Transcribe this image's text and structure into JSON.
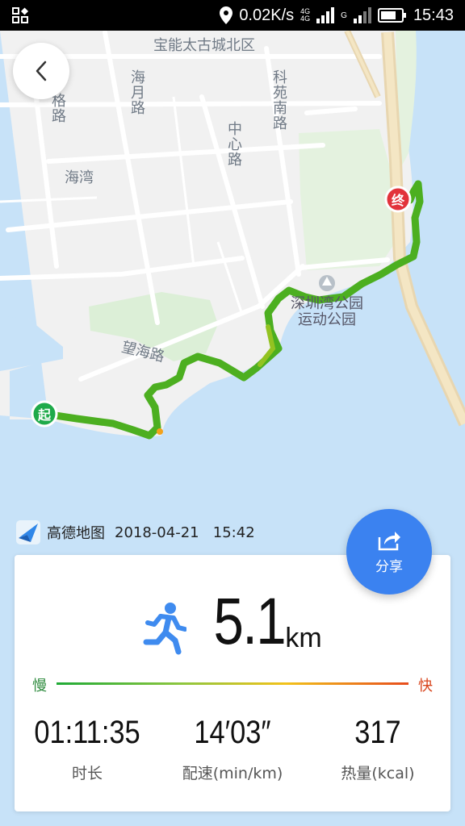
{
  "status_bar": {
    "network_speed": "0.02K/s",
    "sim1_tech": "4G",
    "sim1_tech2": "4G",
    "sim2_tech": "G",
    "time": "15:43",
    "icons": [
      "app-notification-icon",
      "location-icon",
      "signal-icon",
      "battery-icon"
    ]
  },
  "map": {
    "labels": {
      "district": "宝能太古城北区",
      "haiyue_road": "海月路",
      "ge_road": "格路",
      "kejinan_road": "科苑南路",
      "zhongxin_road": "中心路",
      "haiwan": "海湾",
      "wanghai_road": "望海路",
      "park_line1": "深圳湾公园",
      "park_line2": "运动公园"
    },
    "start_marker": "起",
    "end_marker": "终",
    "route_color": "#4caf20",
    "water_color": "#c7e2f8",
    "land_color": "#f1f1f1"
  },
  "attribution": {
    "brand": "高德地图",
    "datetime": "2018-04-21   15:42"
  },
  "share": {
    "label": "分享",
    "icon": "share-icon"
  },
  "summary": {
    "activity_icon": "running-icon",
    "distance": "5.1",
    "distance_unit": "km",
    "slow_label": "慢",
    "fast_label": "快",
    "stats": [
      {
        "value": "01:11:35",
        "label": "时长"
      },
      {
        "value": "14′03″",
        "label": "配速(min/km)"
      },
      {
        "value": "317",
        "label": "热量(kcal)"
      }
    ]
  }
}
